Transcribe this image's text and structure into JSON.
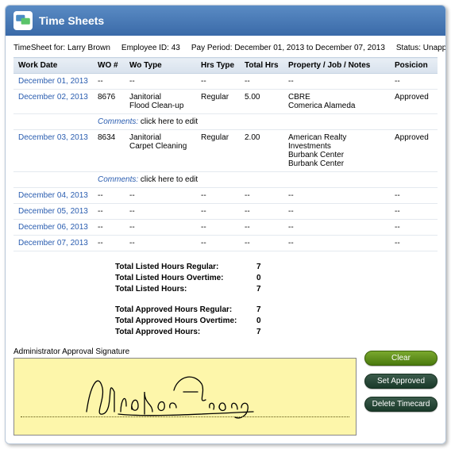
{
  "header": {
    "title": "Time Sheets"
  },
  "meta": {
    "timesheet_for": "TimeSheet for: Larry Brown",
    "employee_id": "Employee ID: 43",
    "pay_period": "Pay Period: December 01, 2013 to December 07, 2013",
    "status": "Status: Unapproved"
  },
  "columns": {
    "work_date": "Work Date",
    "wo_num": "WO #",
    "wo_type": "Wo Type",
    "hrs_type": "Hrs Type",
    "total_hrs": "Total Hrs",
    "property": "Property / Job / Notes",
    "position": "Posicion"
  },
  "rows": [
    {
      "date": "December 01, 2013",
      "wo": "--",
      "type": "--",
      "hrs_type": "--",
      "total": "--",
      "prop": "--",
      "pos": "--",
      "comments": null
    },
    {
      "date": "December 02, 2013",
      "wo": "8676",
      "type": "Janitorial\nFlood Clean-up",
      "hrs_type": "Regular",
      "total": "5.00",
      "prop": "CBRE\nComerica Alameda",
      "pos": "Approved",
      "comments": "click here to edit"
    },
    {
      "date": "December 03, 2013",
      "wo": "8634",
      "type": "Janitorial\nCarpet Cleaning",
      "hrs_type": "Regular",
      "total": "2.00",
      "prop": "American Realty Investments\nBurbank Center\nBurbank Center",
      "pos": "Approved",
      "comments": "click here to edit"
    },
    {
      "date": "December 04, 2013",
      "wo": "--",
      "type": "--",
      "hrs_type": "--",
      "total": "--",
      "prop": "--",
      "pos": "--",
      "comments": null
    },
    {
      "date": "December 05, 2013",
      "wo": "--",
      "type": "--",
      "hrs_type": "--",
      "total": "--",
      "prop": "--",
      "pos": "--",
      "comments": null
    },
    {
      "date": "December 06, 2013",
      "wo": "--",
      "type": "--",
      "hrs_type": "--",
      "total": "--",
      "prop": "--",
      "pos": "--",
      "comments": null
    },
    {
      "date": "December 07, 2013",
      "wo": "--",
      "type": "--",
      "hrs_type": "--",
      "total": "--",
      "prop": "--",
      "pos": "--",
      "comments": null
    }
  ],
  "comments_label": "Comments:",
  "totals": {
    "listed_regular_label": "Total Listed Hours Regular:",
    "listed_regular_value": "7",
    "listed_overtime_label": "Total Listed Hours Overtime:",
    "listed_overtime_value": "0",
    "listed_total_label": "Total Listed Hours:",
    "listed_total_value": "7",
    "approved_regular_label": "Total Approved Hours Regular:",
    "approved_regular_value": "7",
    "approved_overtime_label": "Total Approved Hours Overtime:",
    "approved_overtime_value": "0",
    "approved_total_label": "Total Approved Hours:",
    "approved_total_value": "7"
  },
  "signature": {
    "label": "Administrator Approval Signature"
  },
  "buttons": {
    "clear": "Clear",
    "set_approved": "Set Approved",
    "delete_timecard": "Delete Timecard"
  }
}
